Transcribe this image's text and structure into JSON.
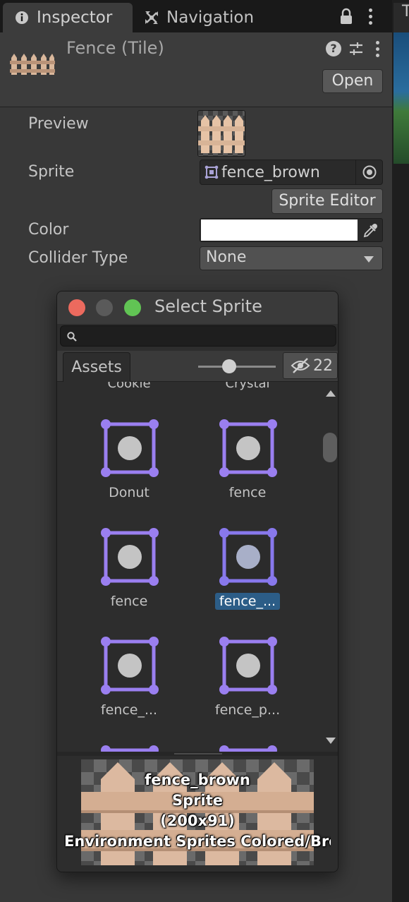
{
  "tabs": {
    "inspector_label": "Inspector",
    "navigation_label": "Navigation"
  },
  "right_strip": {
    "tab_stub": "T"
  },
  "header": {
    "title": "Fence (Tile)",
    "help_glyph": "?",
    "open_label": "Open"
  },
  "properties": {
    "preview_label": "Preview",
    "sprite_label": "Sprite",
    "sprite_value": "fence_brown",
    "sprite_editor_label": "Sprite Editor",
    "color_label": "Color",
    "color_value": "#FFFFFF",
    "collider_label": "Collider Type",
    "collider_value": "None"
  },
  "select_sprite": {
    "title": "Select Sprite",
    "search_placeholder": "",
    "assets_tab": "Assets",
    "zoom_level": 0.4,
    "hidden_count": "22",
    "cut_labels": [
      "Cookie",
      "Crystal"
    ],
    "items": [
      {
        "label": "Donut",
        "selected": false
      },
      {
        "label": "fence",
        "selected": false
      },
      {
        "label": "fence",
        "selected": false
      },
      {
        "label": "fence_...",
        "selected": true
      },
      {
        "label": "fence_...",
        "selected": false
      },
      {
        "label": "fence_p...",
        "selected": false
      }
    ],
    "preview_info": {
      "name": "fence_brown",
      "type": "Sprite",
      "size": "(200x91)",
      "path": "Environment Sprites Colored/Bro"
    }
  },
  "colors": {
    "panel_bg": "#383838",
    "selection": "#2c5d87",
    "sprite_icon": "#9a7ff0",
    "close": "#ec6a5e",
    "minimize": "#5a5a5a",
    "maximize": "#61c454"
  }
}
